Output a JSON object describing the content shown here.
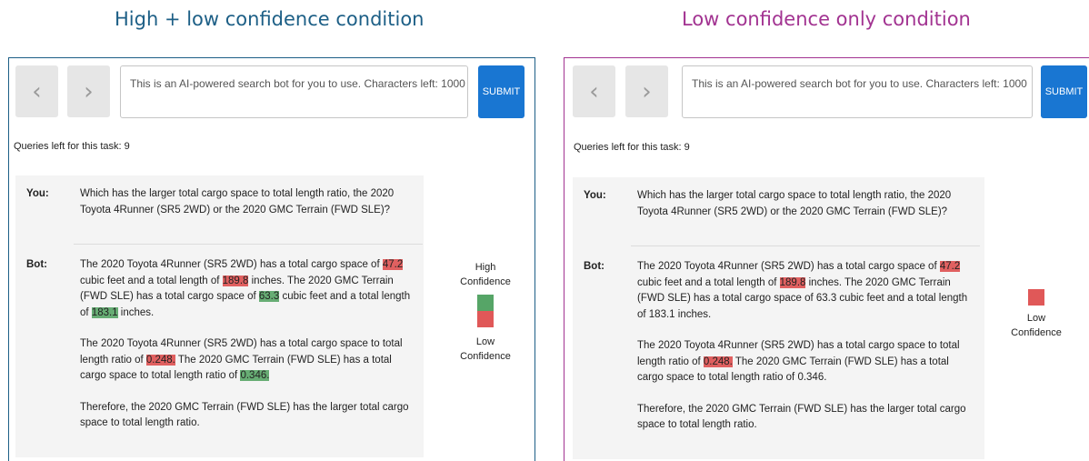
{
  "conditions": [
    {
      "title": "High + low confidence condition",
      "search": {
        "placeholder": "This is an AI-powered search bot for you to use. Characters left: 1000"
      },
      "submit_label": "SUBMIT",
      "queries_left": "Queries left for this task: 9",
      "you_label": "You:",
      "you_text": "Which has the larger total cargo space to total length ratio, the 2020 Toyota 4Runner (SR5 2WD) or the 2020 GMC Terrain (FWD SLE)?",
      "bot_label": "Bot:",
      "bot_paragraphs": [
        [
          {
            "t": "The 2020 Toyota 4Runner (SR5 2WD) has a total cargo space of ",
            "hl": ""
          },
          {
            "t": "47.2",
            "hl": "low"
          },
          {
            "t": " cubic feet and a total length of ",
            "hl": ""
          },
          {
            "t": "189.8",
            "hl": "low"
          },
          {
            "t": " inches. The 2020 GMC Terrain (FWD SLE) has a total cargo space of ",
            "hl": ""
          },
          {
            "t": "63.3",
            "hl": "high"
          },
          {
            "t": " cubic feet and a total length of ",
            "hl": ""
          },
          {
            "t": "183.1",
            "hl": "high"
          },
          {
            "t": " inches.",
            "hl": ""
          }
        ],
        [
          {
            "t": "The 2020 Toyota 4Runner (SR5 2WD) has a total cargo space to total length ratio of ",
            "hl": ""
          },
          {
            "t": "0.248.",
            "hl": "low"
          },
          {
            "t": " The 2020 GMC Terrain (FWD SLE) has a total cargo space to total length ratio of ",
            "hl": ""
          },
          {
            "t": "0.346.",
            "hl": "high"
          }
        ],
        [
          {
            "t": "Therefore, the 2020 GMC Terrain (FWD SLE) has the larger total cargo space to total length ratio.",
            "hl": ""
          }
        ]
      ],
      "legend": {
        "high_label": "High\nConfidence",
        "low_label": "Low\nConfidence"
      }
    },
    {
      "title": "Low confidence only condition",
      "search": {
        "placeholder": "This is an AI-powered search bot for you to use. Characters left: 1000"
      },
      "submit_label": "SUBMIT",
      "queries_left": "Queries left for this task: 9",
      "you_label": "You:",
      "you_text": "Which has the larger total cargo space to total length ratio, the 2020 Toyota 4Runner (SR5 2WD) or the 2020 GMC Terrain (FWD SLE)?",
      "bot_label": "Bot:",
      "bot_paragraphs": [
        [
          {
            "t": "The 2020 Toyota 4Runner (SR5 2WD) has a total cargo space of ",
            "hl": ""
          },
          {
            "t": "47.2",
            "hl": "low"
          },
          {
            "t": " cubic feet and a total length of ",
            "hl": ""
          },
          {
            "t": "189.8",
            "hl": "low"
          },
          {
            "t": " inches. The 2020 GMC Terrain (FWD SLE) has a total cargo space of 63.3 cubic feet and a total length of 183.1 inches.",
            "hl": ""
          }
        ],
        [
          {
            "t": "The 2020 Toyota 4Runner (SR5 2WD) has a total cargo space to total length ratio of ",
            "hl": ""
          },
          {
            "t": "0.248.",
            "hl": "low"
          },
          {
            "t": " The 2020 GMC Terrain (FWD SLE) has a total cargo space to total length ratio of 0.346.",
            "hl": ""
          }
        ],
        [
          {
            "t": "Therefore, the 2020 GMC Terrain (FWD SLE) has the larger total cargo space to total length ratio.",
            "hl": ""
          }
        ]
      ],
      "legend": {
        "low_label": "Low\nConfidence"
      }
    }
  ],
  "colors": {
    "left_border": "#1d5f86",
    "right_border": "#a23391",
    "low_highlight": "#e06060",
    "high_highlight": "#67ad74",
    "submit": "#1976d2"
  },
  "icons": {
    "back": "chevron-left-icon",
    "forward": "chevron-right-icon"
  }
}
